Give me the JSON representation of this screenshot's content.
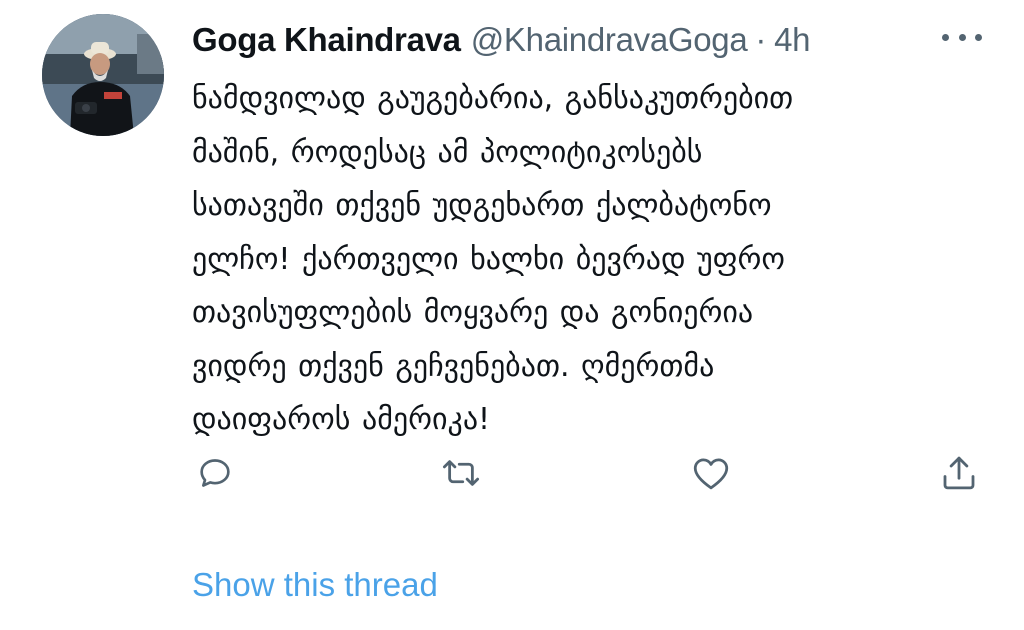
{
  "tweet": {
    "author_name": "Goga Khaindrava",
    "handle": "@KhaindravaGoga",
    "separator": "·",
    "time": "4h",
    "text_lines": [
      "ნამდვილად გაუგებარია, განსაკუთრებით",
      "მაშინ, როდესაც ამ პოლიტიკოსებს",
      "სათავეში თქვენ უდგეხართ ქალბატონო",
      "ელჩო! ქართველი ხალხი ბევრად უფრო",
      "თავისუფლების მოყვარე და გონიერია",
      "ვიდრე თქვენ გეჩვენებათ. ღმერთმა",
      "დაიფაროს ამერიკა!"
    ]
  },
  "actions": {
    "reply_icon": "reply-icon",
    "retweet_icon": "retweet-icon",
    "like_icon": "heart-icon",
    "share_icon": "share-icon"
  },
  "show_thread_label": "Show this thread",
  "colors": {
    "text": "#0f1419",
    "secondary": "#536471",
    "link": "#4aa2e8"
  }
}
